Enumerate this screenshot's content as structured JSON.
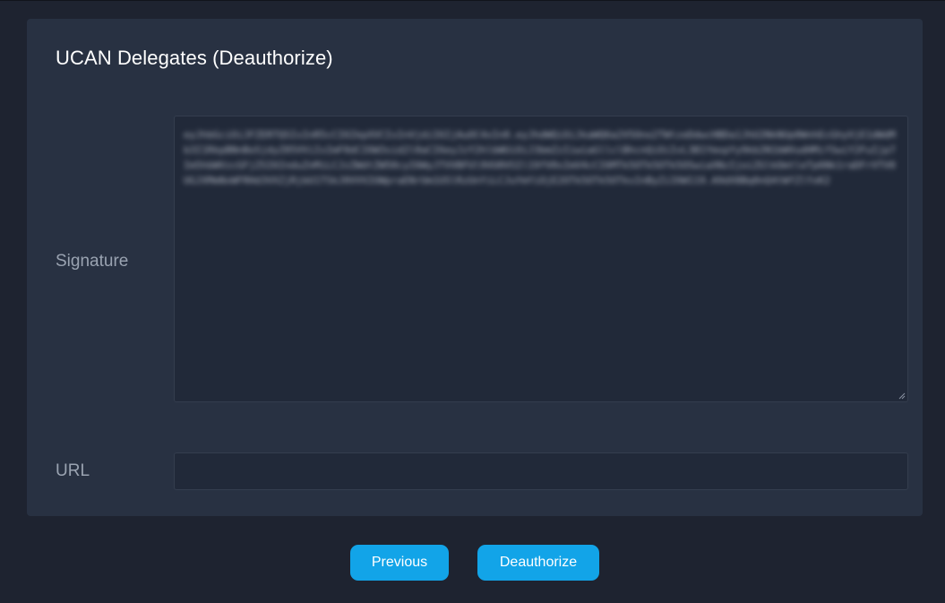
{
  "panel": {
    "title": "UCAN Delegates (Deauthorize)"
  },
  "form": {
    "signature_label": "Signature",
    "signature_value": "eyJhbGciOiJFZERTQSIsInR5cCI6IkpXVCIsInVjdiI6IjAuOC4xIn0.eyJhdWQiOiJkaWQ6a2V5Ono2TWtzeDdwcHBDa1JhU2NkNUp0WnhEcGhyVjE1dWdMb3I1RkpBNnBoSjdyZ05VViIsImF0dCI6W3sid2l0aCI6eyJzY2hlbWUiOiJ3bmZzIiwiaGllclBhcnQiOiIvL3B1YmxpYy9kb2N1bWVudHMifSwiY2FuIjp7Im5hbWVzcGFjZSI6InduZnMiLCJzZWdtZW50cyI6WyJTVVBFUl9VU0VSIl19fV0sImV4cCI6MTk5OTk5OTk5OSwiaXNzIjoiZGlkOmtleTp6Nk1raDFrVTV0UGJXMmNxWFRHd3VXZjRjbU1TSkJ0VVV2UWpraENrUm1USlRzUnYiLCJuYmYiOjE2OTk5OTk5OTksInByZiI6W119.A9dX8Bq0nQ4tWfZlYxK2",
    "url_label": "URL",
    "url_value": "",
    "url_placeholder": ""
  },
  "actions": {
    "previous_label": "Previous",
    "deauthorize_label": "Deauthorize"
  },
  "colors": {
    "background": "#1e2330",
    "panel": "#283142",
    "input_bg": "#212939",
    "accent": "#12a4e8"
  }
}
